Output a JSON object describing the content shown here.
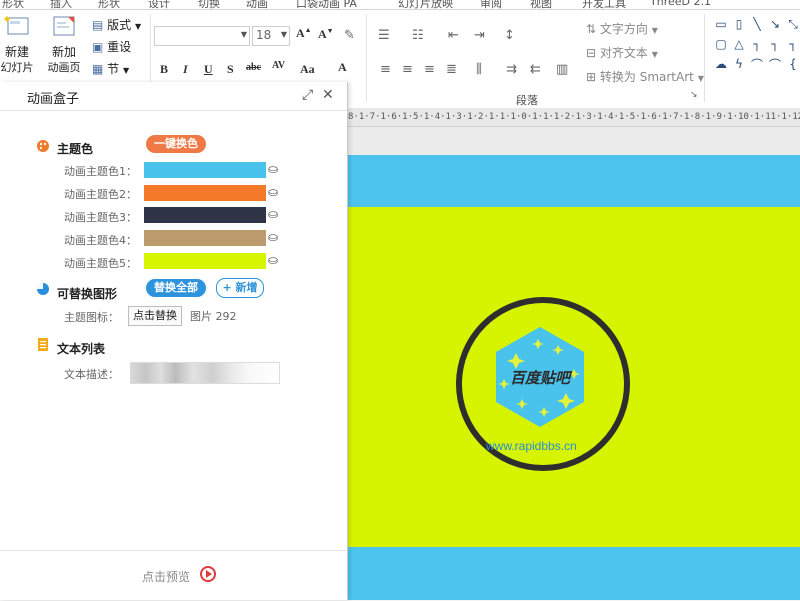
{
  "tabs": [
    "形状",
    "插入",
    "形状",
    "设计",
    "切换",
    "动画",
    "口袋动画 PA",
    "幻灯片放映",
    "审阅",
    "视图",
    "开发工具",
    "ThreeD 2.1"
  ],
  "slides_group": {
    "new_slide": "新建",
    "new_slide_sub": "幻灯片",
    "add_anim": "新加",
    "add_anim_sub": "动画页",
    "layout": "版式",
    "reset": "重设",
    "section": "节"
  },
  "font_group": {
    "font_size": "18"
  },
  "paragraph_group": {
    "label": "段落",
    "text_direction": "文字方向",
    "align_text": "对齐文本",
    "convert_smartart": "转换为 SmartArt"
  },
  "ruler_text": "8·1·7·1·6·1·5·1·4·1·3·1·2·1·1·1·0·1·1·1·2·1·3·1·4·1·5·1·6·1·7·1·8·1·9·1·10·1·11·1·12",
  "panel": {
    "title": "动画盒子",
    "theme": {
      "title": "主题色",
      "one_click": "一键换色",
      "rows": [
        {
          "label": "动画主题色1：",
          "color": "#4ac3ec"
        },
        {
          "label": "动画主题色2：",
          "color": "#f47a2a"
        },
        {
          "label": "动画主题色3：",
          "color": "#2f3447"
        },
        {
          "label": "动画主题色4：",
          "color": "#bd9a6c"
        },
        {
          "label": "动画主题色5：",
          "color": "#d7f400"
        }
      ]
    },
    "shapes": {
      "title": "可替换图形",
      "replace_all": "替换全部",
      "add_new": "+ 新增",
      "icon_label": "主题图标：",
      "click_replace": "点击替换",
      "picture": "图片 292"
    },
    "text_list": {
      "title": "文本列表",
      "desc_label": "文本描述："
    },
    "preview": "点击预览"
  },
  "slide": {
    "logo_text": "百度贴吧",
    "url": "www.rapidbbs.cn"
  }
}
